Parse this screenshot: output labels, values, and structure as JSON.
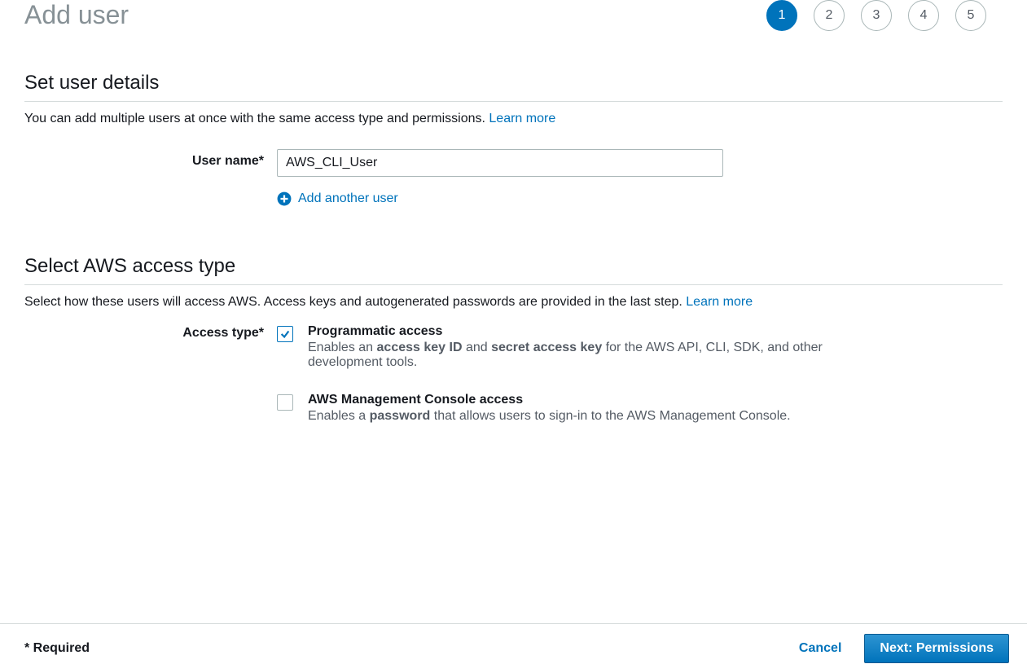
{
  "page": {
    "title": "Add user",
    "steps": [
      {
        "label": "1",
        "active": true
      },
      {
        "label": "2",
        "active": false
      },
      {
        "label": "3",
        "active": false
      },
      {
        "label": "4",
        "active": false
      },
      {
        "label": "5",
        "active": false
      }
    ]
  },
  "userDetails": {
    "sectionTitle": "Set user details",
    "description": "You can add multiple users at once with the same access type and permissions. ",
    "learnMore": "Learn more",
    "userNameLabel": "User name*",
    "userNameValue": "AWS_CLI_User",
    "addAnotherLabel": "Add another user"
  },
  "accessType": {
    "sectionTitle": "Select AWS access type",
    "description": "Select how these users will access AWS. Access keys and autogenerated passwords are provided in the last step. ",
    "learnMore": "Learn more",
    "label": "Access type*",
    "options": [
      {
        "checked": true,
        "title": "Programmatic access",
        "descPre": "Enables an ",
        "descBold1": "access key ID",
        "descMid": " and ",
        "descBold2": "secret access key",
        "descPost": " for the AWS API, CLI, SDK, and other development tools."
      },
      {
        "checked": false,
        "title": "AWS Management Console access",
        "descPre": "Enables a ",
        "descBold1": "password",
        "descMid": "",
        "descBold2": "",
        "descPost": " that allows users to sign-in to the AWS Management Console."
      }
    ]
  },
  "footer": {
    "requiredNote": "* Required",
    "cancel": "Cancel",
    "next": "Next: Permissions"
  }
}
